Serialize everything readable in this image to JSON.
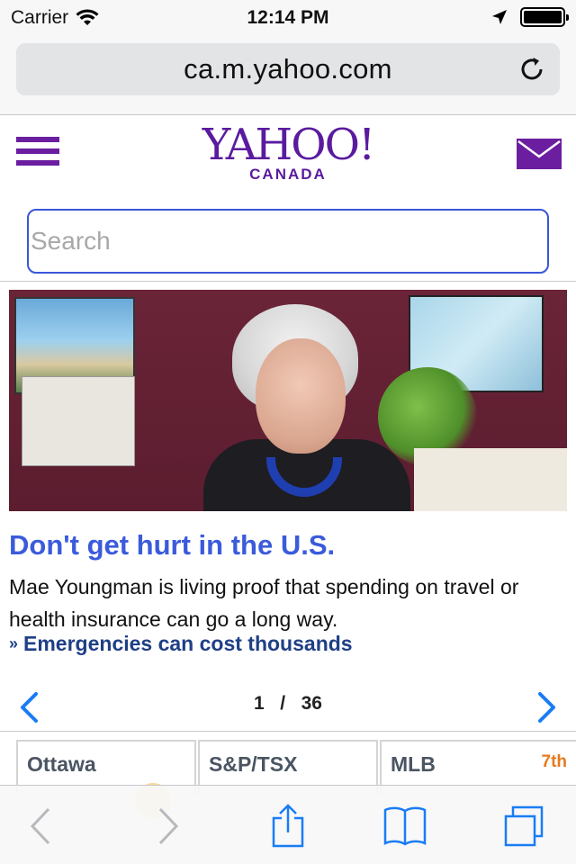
{
  "status_bar": {
    "carrier": "Carrier",
    "time": "12:14 PM"
  },
  "browser": {
    "url": "ca.m.yahoo.com"
  },
  "header": {
    "logo_text": "YAHOO!",
    "logo_subtext": "CANADA"
  },
  "search": {
    "placeholder": "Search"
  },
  "article": {
    "headline": "Don't get hurt in the U.S.",
    "summary": "Mae Youngman is living proof that spending on travel or health insurance can go a long way.",
    "link": "Emergencies can cost thousands"
  },
  "pager": {
    "current": "1",
    "separator": "/",
    "total": "36"
  },
  "cards": [
    {
      "title": "Ottawa"
    },
    {
      "title": "S&P/TSX"
    },
    {
      "title": "MLB",
      "badge": "7th"
    }
  ],
  "colors": {
    "yahoo_purple": "#5a1b9e",
    "headline_blue": "#3b5bdb",
    "link_navy": "#1f3f86",
    "ios_blue": "#1a7cf5",
    "badge_orange": "#e67a1e"
  }
}
